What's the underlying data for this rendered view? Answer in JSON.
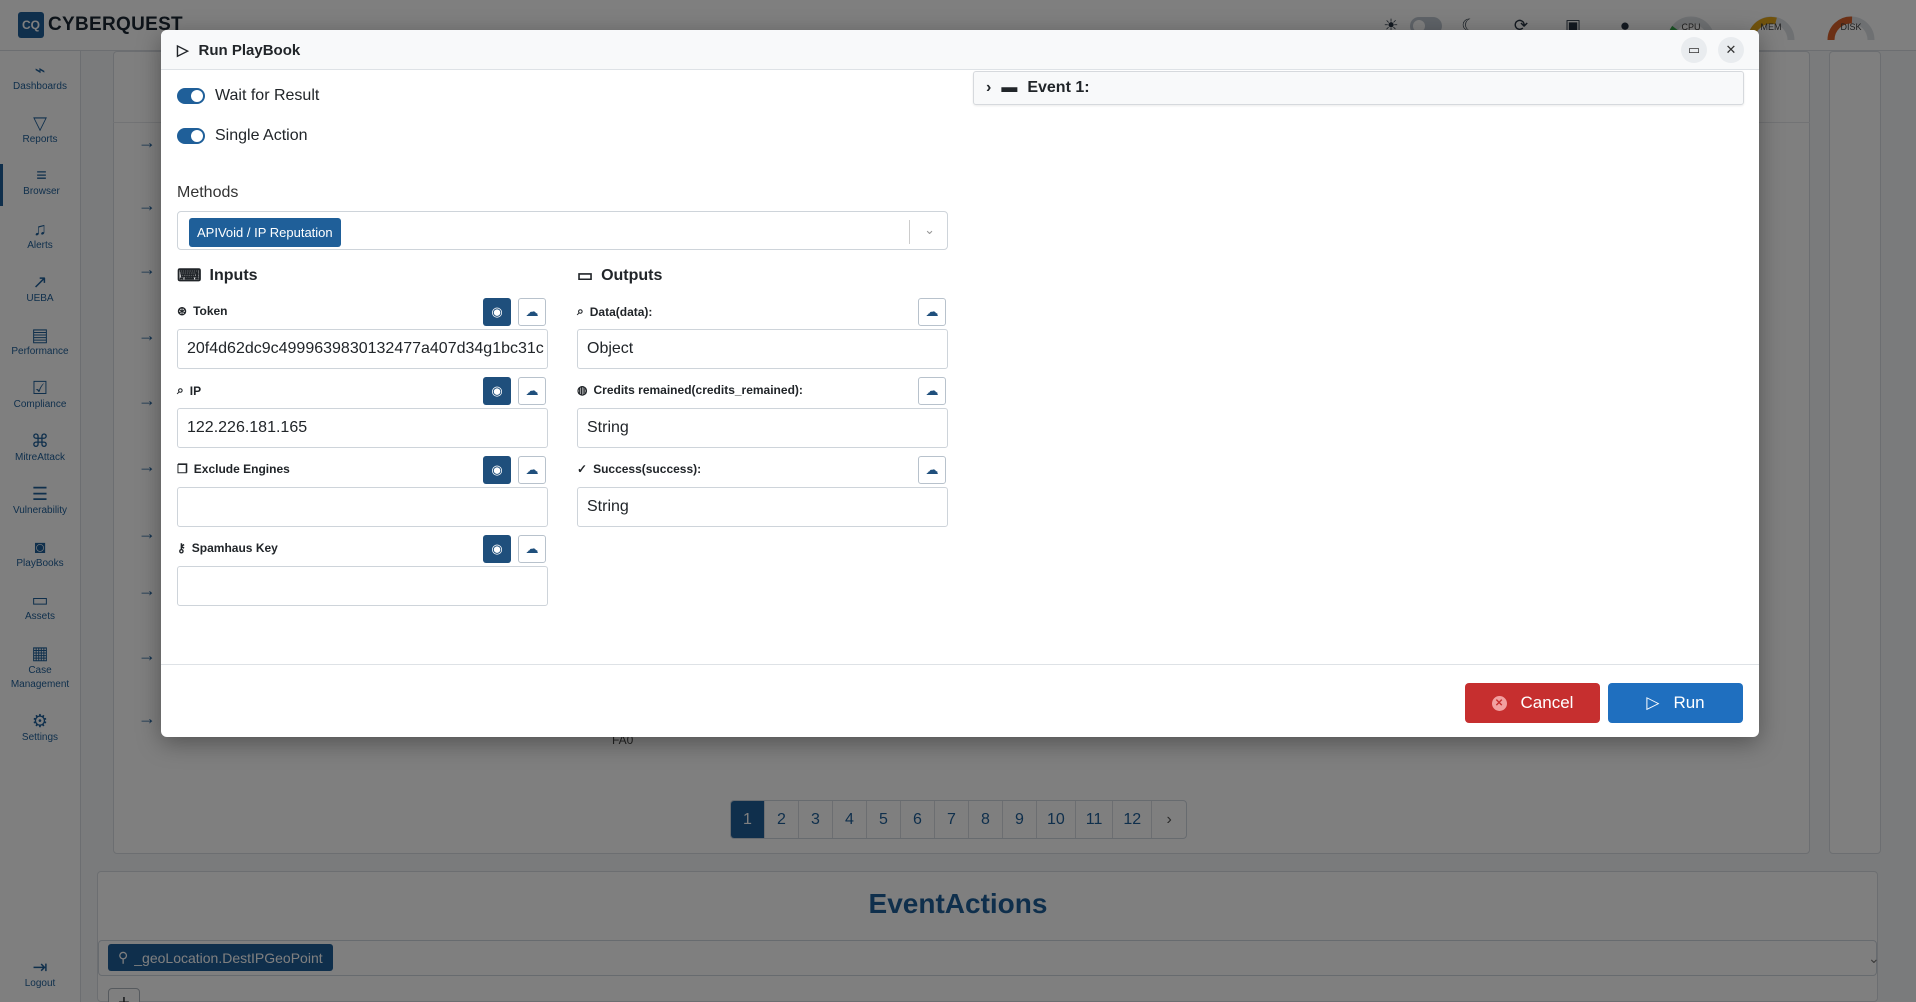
{
  "app": {
    "logo_mark": "CQ",
    "logo_text": "CYBERQUEST",
    "gauges": [
      {
        "label": "CPU",
        "min": "",
        "max": "",
        "color": "#3aa84f"
      },
      {
        "label": "MEM",
        "min": "",
        "max": "100",
        "color": "#e2a61b"
      },
      {
        "label": "DISK",
        "min": "0",
        "max": "100",
        "color": "#d8612a"
      }
    ]
  },
  "sidebar": {
    "items": [
      {
        "label": "Dashboards",
        "icon": "dashboard-icon"
      },
      {
        "label": "Reports",
        "icon": "filter-icon"
      },
      {
        "label": "Browser",
        "icon": "list-icon"
      },
      {
        "label": "Alerts",
        "icon": "bell-icon"
      },
      {
        "label": "UEBA",
        "icon": "chart-icon"
      },
      {
        "label": "Performance",
        "icon": "keyboard-icon"
      },
      {
        "label": "Compliance",
        "icon": "compliance-icon"
      },
      {
        "label": "MitreAttack",
        "icon": "command-icon"
      },
      {
        "label": "Vulnerability",
        "icon": "server-icon"
      },
      {
        "label": "PlayBooks",
        "icon": "playbook-icon"
      },
      {
        "label": "Assets",
        "icon": "laptop-icon"
      },
      {
        "label": "Case\nManagement",
        "icon": "briefcase-icon"
      },
      {
        "label": "Settings",
        "icon": "gear-icon"
      }
    ],
    "logout": "Logout"
  },
  "background": {
    "stray_text": "FA0",
    "pages": [
      "1",
      "2",
      "3",
      "4",
      "5",
      "6",
      "7",
      "8",
      "9",
      "10",
      "11",
      "12",
      "›"
    ],
    "active_page": "1",
    "event_actions_title": "EventActions",
    "event_actions_tag": "_geoLocation.DestIPGeoPoint",
    "add_label": "+"
  },
  "modal": {
    "title": "Run PlayBook",
    "wait_for_result": "Wait for Result",
    "single_action": "Single Action",
    "methods_label": "Methods",
    "method_selected": "APIVoid / IP Reputation",
    "inputs_title": "Inputs",
    "outputs_title": "Outputs",
    "inputs": [
      {
        "label": "Token",
        "value": "20f4d62dc9c4999639830132477a407d34g1bc31c"
      },
      {
        "label": "IP",
        "value": "122.226.181.165"
      },
      {
        "label": "Exclude Engines",
        "value": ""
      },
      {
        "label": "Spamhaus Key",
        "value": ""
      }
    ],
    "outputs": [
      {
        "label": "Data(data):",
        "value": "Object"
      },
      {
        "label": "Credits remained(credits_remained):",
        "value": "String"
      },
      {
        "label": "Success(success):",
        "value": "String"
      }
    ],
    "event_label": "Event 1:",
    "cancel": "Cancel",
    "run": "Run"
  }
}
